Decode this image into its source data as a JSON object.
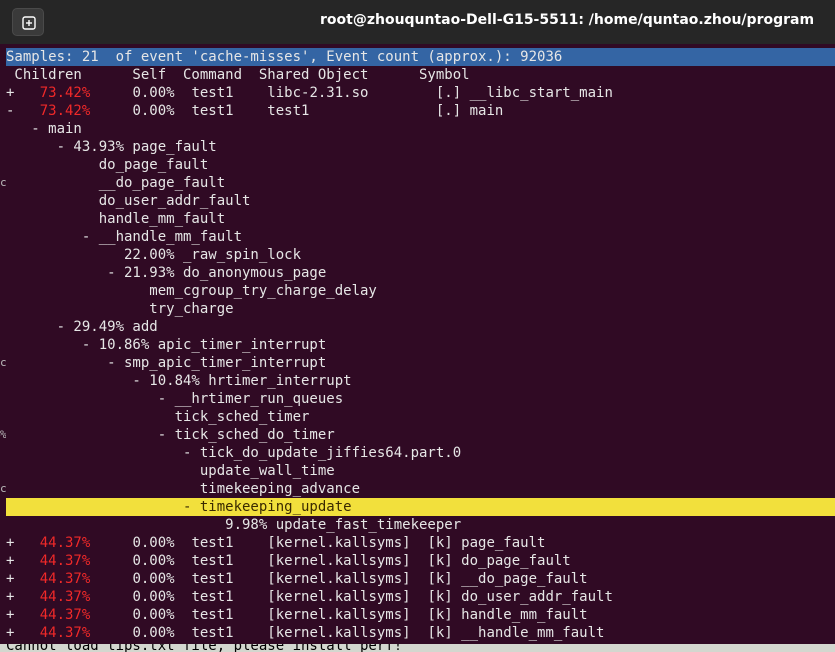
{
  "window": {
    "title": "root@zhouquntao-Dell-G15-5511: /home/quntao.zhou/program"
  },
  "perf": {
    "header": "Samples: 21  of event 'cache-misses', Event count (approx.): 92036",
    "columns": " Children      Self  Command  Shared Object      Symbol",
    "rows": [
      {
        "prefix": "+ ",
        "pct": "  73.42%",
        "rest": "     0.00%  test1    libc-2.31.so        [.] __libc_start_main"
      },
      {
        "prefix": "- ",
        "pct": "  73.42%",
        "rest": "     0.00%  test1    test1               [.] main"
      },
      {
        "text": "   - main"
      },
      {
        "text": "      - 43.93% page_fault"
      },
      {
        "text": "           do_page_fault"
      },
      {
        "text": "           __do_page_fault"
      },
      {
        "text": "           do_user_addr_fault"
      },
      {
        "text": "           handle_mm_fault"
      },
      {
        "text": "         - __handle_mm_fault"
      },
      {
        "text": "              22.00% _raw_spin_lock"
      },
      {
        "text": "            - 21.93% do_anonymous_page"
      },
      {
        "text": "                 mem_cgroup_try_charge_delay"
      },
      {
        "text": "                 try_charge"
      },
      {
        "text": "      - 29.49% add"
      },
      {
        "text": "         - 10.86% apic_timer_interrupt"
      },
      {
        "text": "            - smp_apic_timer_interrupt"
      },
      {
        "text": "               - 10.84% hrtimer_interrupt"
      },
      {
        "text": "                  - __hrtimer_run_queues"
      },
      {
        "text": "                    tick_sched_timer"
      },
      {
        "text": "                  - tick_sched_do_timer"
      },
      {
        "text": "                     - tick_do_update_jiffies64.part.0"
      },
      {
        "text": "                       update_wall_time"
      },
      {
        "text": "                       timekeeping_advance"
      },
      {
        "text": "                     - timekeeping_update",
        "selected": true
      },
      {
        "text": "                          9.98% update_fast_timekeeper"
      },
      {
        "prefix": "+ ",
        "pct": "  44.37%",
        "rest": "     0.00%  test1    [kernel.kallsyms]  [k] page_fault"
      },
      {
        "prefix": "+ ",
        "pct": "  44.37%",
        "rest": "     0.00%  test1    [kernel.kallsyms]  [k] do_page_fault"
      },
      {
        "prefix": "+ ",
        "pct": "  44.37%",
        "rest": "     0.00%  test1    [kernel.kallsyms]  [k] __do_page_fault"
      },
      {
        "prefix": "+ ",
        "pct": "  44.37%",
        "rest": "     0.00%  test1    [kernel.kallsyms]  [k] do_user_addr_fault"
      },
      {
        "prefix": "+ ",
        "pct": "  44.37%",
        "rest": "     0.00%  test1    [kernel.kallsyms]  [k] handle_mm_fault"
      },
      {
        "prefix": "+ ",
        "pct": "  44.37%",
        "rest": "     0.00%  test1    [kernel.kallsyms]  [k] __handle_mm_fault"
      }
    ],
    "status": "Cannot load tips.txt file, please install perf!"
  },
  "left_edge_fragments": [
    {
      "row": 7,
      "text": "c"
    },
    {
      "row": 17,
      "text": "c"
    },
    {
      "row": 21,
      "text": "%"
    },
    {
      "row": 24,
      "text": "c"
    }
  ],
  "colors": {
    "terminal_bg": "#300a24",
    "header_bg": "#3465a4",
    "selected_bg": "#f2e03c",
    "percent_red": "#ef2929",
    "titlebar_bg": "#262626"
  },
  "icons": {
    "new_tab": "new-tab-icon"
  }
}
